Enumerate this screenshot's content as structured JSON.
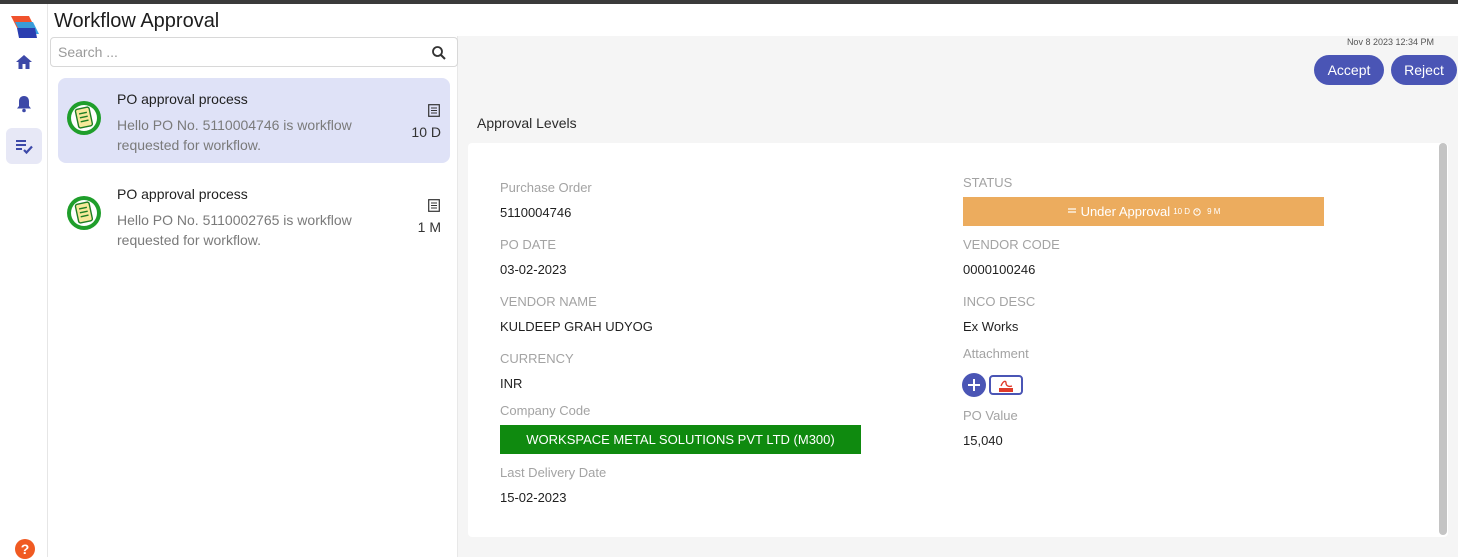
{
  "app": {
    "title": "Workflow Approval"
  },
  "search": {
    "placeholder": "Search ..."
  },
  "list": {
    "items": [
      {
        "title": "PO approval process",
        "message": "Hello PO No. 5110004746 is workflow requested for workflow.",
        "age": "10 D"
      },
      {
        "title": "PO approval process",
        "message": "Hello PO No. 5110002765 is workflow requested for workflow.",
        "age": "1 M"
      }
    ]
  },
  "header": {
    "timestamp": "Nov 8 2023 12:34 PM",
    "accept_label": "Accept",
    "reject_label": "Reject"
  },
  "detail": {
    "section_title": "Approval Levels",
    "purchase_order_label": "Purchase Order",
    "purchase_order": "5110004746",
    "po_date_label": "PO DATE",
    "po_date": "03-02-2023",
    "vendor_name_label": "VENDOR NAME",
    "vendor_name": "KULDEEP GRAH UDYOG",
    "currency_label": "CURRENCY",
    "currency": "INR",
    "company_code_label": "Company Code",
    "company_code": "WORKSPACE METAL SOLUTIONS PVT LTD (M300)",
    "last_delivery_label": "Last Delivery Date",
    "last_delivery": "15-02-2023",
    "status_label": "STATUS",
    "status": "Under Approval",
    "status_age": "10 D",
    "status_time": "9 M",
    "vendor_code_label": "VENDOR CODE",
    "vendor_code": "0000100246",
    "inco_desc_label": "INCO DESC",
    "inco_desc": "Ex Works",
    "attachment_label": "Attachment",
    "po_value_label": "PO Value",
    "po_value": "15,040"
  },
  "colors": {
    "accent": "#4a55b5",
    "status": "#ecac5e",
    "company": "#0f8a0f",
    "selected": "#dfe2f7"
  },
  "icons": [
    "app-logo-icon",
    "home-icon",
    "bell-icon",
    "tasks-icon",
    "help-icon",
    "search-icon",
    "document-icon",
    "list-doc-icon",
    "plus-icon",
    "pdf-icon",
    "clock-icon",
    "flag-icon"
  ]
}
